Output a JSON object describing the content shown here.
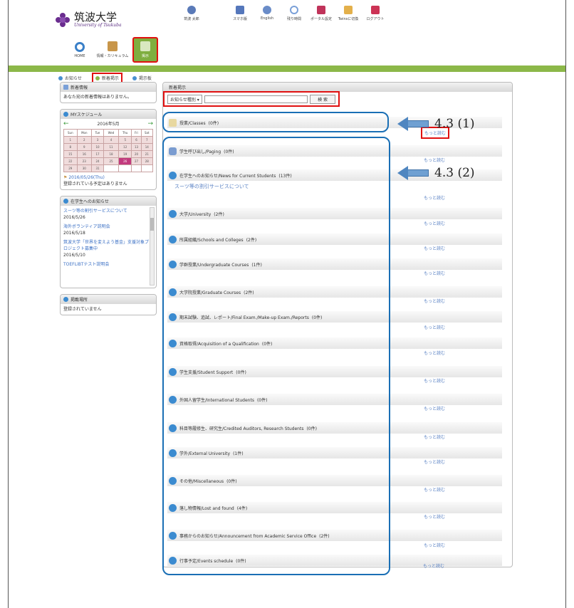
{
  "header": {
    "logo_jp": "筑波大学",
    "logo_en": "University of Tsukuba",
    "user_name": "筑波 太郎",
    "top_nav": [
      {
        "label": "スマホ版",
        "icon": "phone-icon",
        "color": "#5577bb"
      },
      {
        "label": "English",
        "icon": "globe-icon",
        "color": "#6a8cc8"
      },
      {
        "label": "残り時間",
        "icon": "clock-icon",
        "color": "#7aa0d8"
      },
      {
        "label": "ポータル設定",
        "icon": "portal-settings-icon",
        "color": "#c0335a"
      },
      {
        "label": "Twinsに切換",
        "icon": "switch-icon",
        "color": "#e3b04b"
      },
      {
        "label": "ログアウト",
        "icon": "logout-icon",
        "color": "#cc3355"
      }
    ],
    "icon_buttons": [
      {
        "label": "HOME",
        "icon": "home-icon"
      },
      {
        "label": "情報・カリキュラム",
        "icon": "book-icon"
      },
      {
        "label": "掲示",
        "icon": "board-icon"
      }
    ]
  },
  "sub_nav": [
    {
      "label": "お知らせ"
    },
    {
      "label": "新着掲示"
    },
    {
      "label": "掲示板"
    }
  ],
  "sidebar": {
    "new_info": {
      "title": "新着情報",
      "text": "あなた宛の新着情報はありません。"
    },
    "schedule": {
      "title": "MYスケジュール",
      "month": "2016年5月",
      "days": [
        "Sun",
        "Mon",
        "Tue",
        "Wed",
        "Thu",
        "Fri",
        "Sat"
      ],
      "weeks": [
        [
          "1",
          "2",
          "3",
          "4",
          "5",
          "6",
          "7"
        ],
        [
          "8",
          "9",
          "10",
          "11",
          "12",
          "13",
          "14"
        ],
        [
          "15",
          "16",
          "17",
          "18",
          "19",
          "20",
          "21"
        ],
        [
          "22",
          "23",
          "24",
          "25",
          "26",
          "27",
          "28"
        ],
        [
          "29",
          "30",
          "31",
          "",
          "",
          "",
          ""
        ]
      ],
      "today": "26",
      "date_line": "2016/05/26(Thu)",
      "no_events": "登録されている予定はありません"
    },
    "notices": {
      "title": "在学生へのお知らせ",
      "items": [
        {
          "text": "スーツ等の割引サービスについて",
          "date": "2016/5/26"
        },
        {
          "text": "海外ボランティア説明会",
          "date": "2016/5/18"
        },
        {
          "text": "筑波大学「世界を変えよう基金」支援対象プロジェクト募集中",
          "date": "2016/5/10"
        },
        {
          "text": "TOEFLiBTテスト説明会",
          "date": ""
        }
      ]
    },
    "bookmarks": {
      "title": "掲載場所",
      "text": "登録されていません"
    }
  },
  "main": {
    "title": "新着掲示",
    "search": {
      "select": "お知らせ種別 ▾",
      "button": "検 索"
    },
    "more_label": "もっと読む",
    "categories": [
      {
        "label": "授業/Classes",
        "count": "(0件)"
      },
      {
        "label": "学生呼び出し/Paging",
        "count": "(0件)"
      },
      {
        "label": "在学生へのお知らせ/News for Current Students",
        "count": "(13件)",
        "sub": "スーツ等の割引サービスについて"
      },
      {
        "label": "大学/University",
        "count": "(2件)"
      },
      {
        "label": "所属組織/Schools and Colleges",
        "count": "(2件)"
      },
      {
        "label": "学群授業/Undergraduate Courses",
        "count": "(1件)"
      },
      {
        "label": "大学院授業/Graduate Courses",
        "count": "(2件)"
      },
      {
        "label": "期末試験、追試、レポート/Final Exam./Make-up Exam./Reports",
        "count": "(0件)"
      },
      {
        "label": "資格取得/Acquisition of a Qualification",
        "count": "(0件)"
      },
      {
        "label": "学生支援/Student Support",
        "count": "(0件)"
      },
      {
        "label": "外国人留学生/International Students",
        "count": "(0件)"
      },
      {
        "label": "科目等履修生、研究生/Credited Auditors, Research Students",
        "count": "(0件)"
      },
      {
        "label": "学外/External University",
        "count": "(1件)"
      },
      {
        "label": "その他/Miscellaneous",
        "count": "(0件)"
      },
      {
        "label": "落し物情報/Lost and found",
        "count": "(4件)"
      },
      {
        "label": "事務からのお知らせ/Announcement from Academic Service Office",
        "count": "(2件)"
      },
      {
        "label": "行事予定/Events schedule",
        "count": "(0件)"
      }
    ]
  },
  "annotations": [
    {
      "text": "4.3 (1)"
    },
    {
      "text": "4.3 (2)"
    }
  ],
  "colors": {
    "accent_green": "#8cb849",
    "highlight_red": "#e01010",
    "annotation_blue": "#1a6fb5",
    "link": "#5a82c4"
  }
}
